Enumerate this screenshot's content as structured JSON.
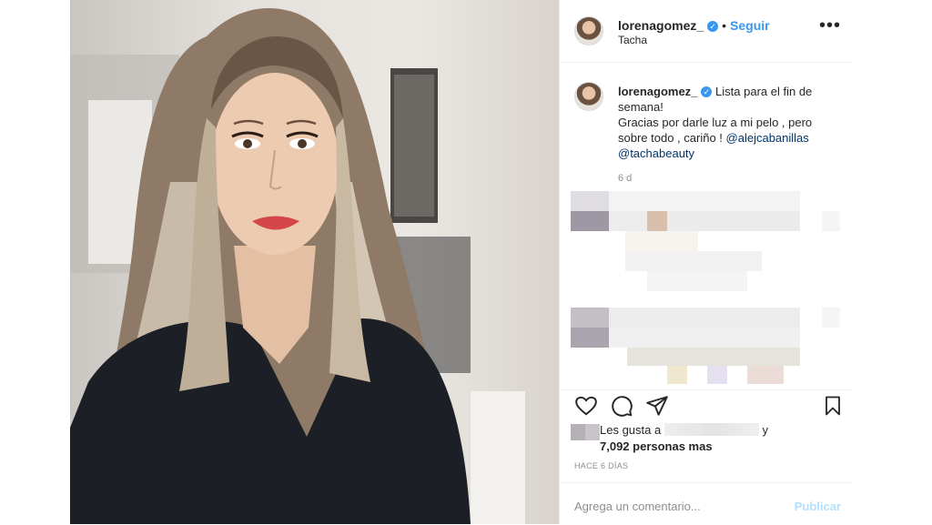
{
  "post": {
    "username": "lorenagomez_",
    "verified_icon": "verified-badge-icon",
    "follow_label": "Seguir",
    "location": "Tacha",
    "more_icon": "more-options-icon",
    "more_glyph": "•••"
  },
  "caption": {
    "username": "lorenagomez_",
    "text_part1": "Lista para el fin de semana!",
    "text_part2": "Gracias por darle luz a mi pelo , pero sobre todo , cariño !",
    "mention1": "@alejcabanillas",
    "mention2": "@tachabeauty",
    "age": "6 d"
  },
  "actions": {
    "like_icon": "heart-icon",
    "comment_icon": "comment-icon",
    "share_icon": "share-icon",
    "save_icon": "bookmark-icon"
  },
  "likes": {
    "prefix": "Les gusta a",
    "suffix": "y",
    "count": "7,092 personas mas"
  },
  "timestamp": "HACE 6 DÍAS",
  "comment": {
    "placeholder": "Agrega un comentario...",
    "publish_label": "Publicar"
  },
  "colors": {
    "accent": "#3897f0",
    "publish_disabled": "#b2dffc",
    "mention": "#003569"
  }
}
